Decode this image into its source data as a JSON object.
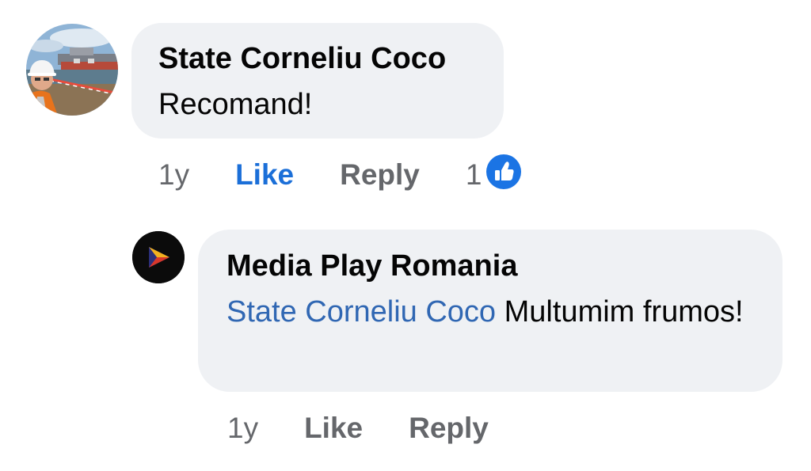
{
  "comments": [
    {
      "author": "State Corneliu Coco",
      "text": "Recomand!",
      "time": "1y",
      "like_label": "Like",
      "reply_label": "Reply",
      "like_state": "liked",
      "reaction_count": "1",
      "reaction_icon": "thumbs-up-icon",
      "avatar": "profile-photo"
    },
    {
      "author": "Media Play Romania",
      "mention": "State Corneliu Coco",
      "text": "Multumim frumos!",
      "time": "1y",
      "like_label": "Like",
      "reply_label": "Reply",
      "like_state": "not-liked",
      "avatar": "media-play-logo"
    }
  ],
  "colors": {
    "bubble": "#eff1f4",
    "like_active": "#1b6fd8",
    "secondary_text": "#65676b",
    "mention": "#3067b3",
    "reaction_badge": "#1b74e4"
  }
}
